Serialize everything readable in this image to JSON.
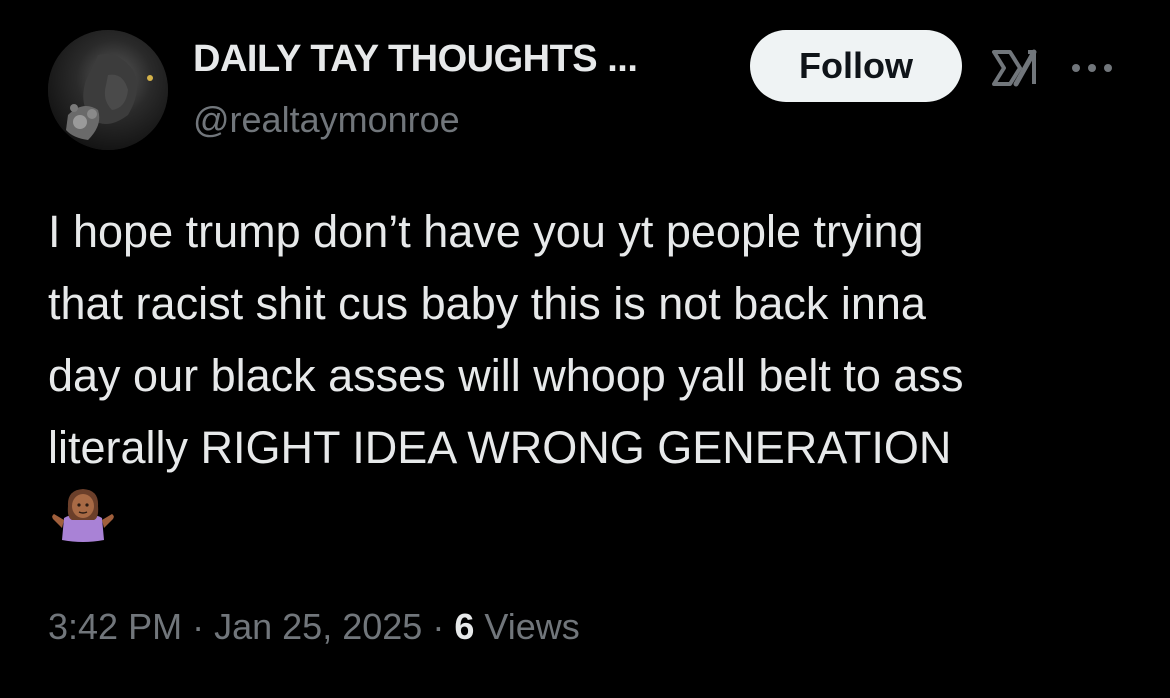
{
  "author": {
    "display_name": "DAILY TAY THOUGHTS ...",
    "handle": "@realtaymonroe",
    "avatar_icon": "profile-photo"
  },
  "actions": {
    "follow_label": "Follow",
    "grok_icon": "grok-icon",
    "more_icon": "more-horizontal-icon"
  },
  "tweet": {
    "text": "I hope trump don’t have you yt people trying\nthat racist shit cus baby this is not back inna\nday our black asses will whoop yall belt to ass\nliterally RIGHT IDEA WRONG GENERATION",
    "emoji": "🤷🏾‍♀️",
    "time": "3:42 PM",
    "separator": "·",
    "date": "Jan 25, 2025",
    "views_count": "6",
    "views_label": "Views"
  },
  "colors": {
    "background": "#000000",
    "primary_text": "#e7e9ea",
    "secondary_text": "#71767b",
    "follow_bg": "#eff3f4",
    "follow_text": "#0f1419"
  }
}
